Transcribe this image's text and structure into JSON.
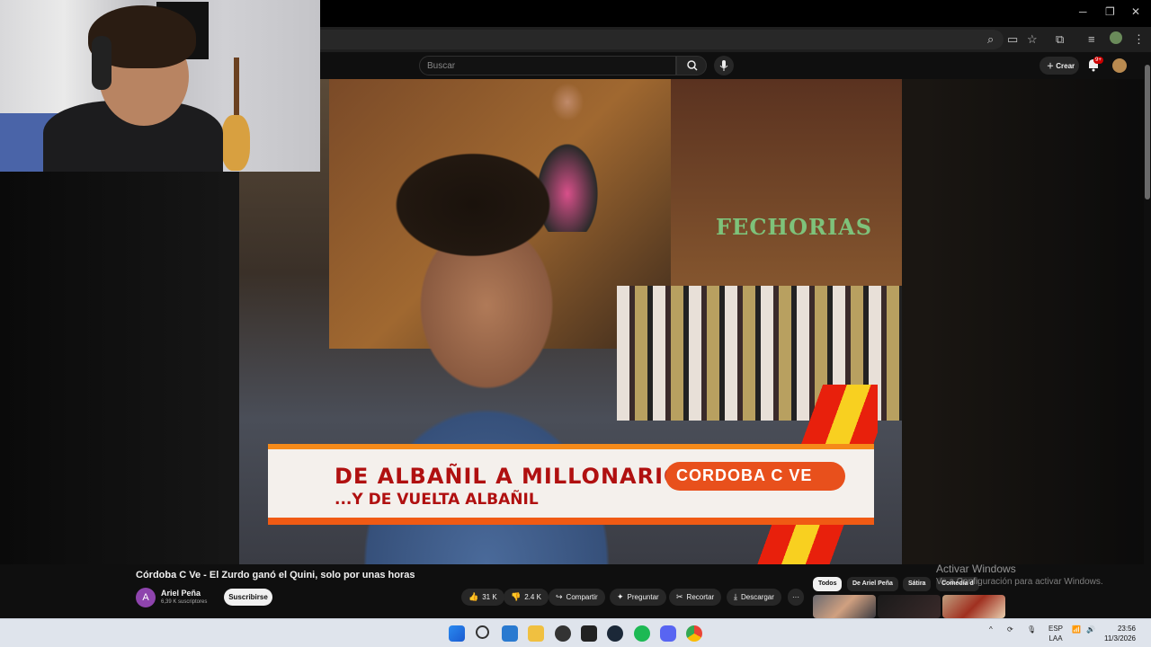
{
  "browser": {
    "window_controls": {
      "minimize": "─",
      "restore": "❐",
      "close": "✕"
    },
    "icons": [
      "zoom-icon",
      "cast-icon",
      "bookmark-star-icon",
      "extensions-icon",
      "media-icon",
      "profile-icon",
      "menu-icon"
    ]
  },
  "youtube": {
    "search_placeholder": "Buscar",
    "create_label": "Crear",
    "notifications_badge": "9+"
  },
  "video_overlay": {
    "store_sign": "FECHORIAS",
    "lower_third_line1": "DE ALBAÑIL A MILLONARIO...",
    "lower_third_line2": "...Y DE VUELTA ALBAÑIL",
    "logo_text": "CORDOBA C VE"
  },
  "video": {
    "title": "Córdoba C Ve - El Zurdo ganó el Quini, solo por unas horas",
    "channel_initial": "A",
    "channel_name": "Ariel Peña",
    "subscribers": "6,39 K suscriptores",
    "subscribe_label": "Suscribirse",
    "likes": "31 K",
    "dislikes": "2.4 K",
    "share_label": "Compartir",
    "ask_label": "Preguntar",
    "clip_label": "Recortar",
    "download_label": "Descargar",
    "more_label": "···"
  },
  "chips": [
    "Todos",
    "De Ariel Peña",
    "Sátira",
    "Comedia d"
  ],
  "windows_activation": {
    "title": "Activar Windows",
    "subtitle": "Ve a Configuración para activar Windows."
  },
  "taskbar": {
    "lang_line1": "ESP",
    "lang_line2": "LAA",
    "time": "23:56",
    "date": "11/3/2026"
  },
  "colors": {
    "yt_bg": "#0f0f0f",
    "lower_third_red": "#b01010",
    "lower_third_orange": "#f58a1a",
    "taskbar_bg": "#dfe4ec"
  }
}
